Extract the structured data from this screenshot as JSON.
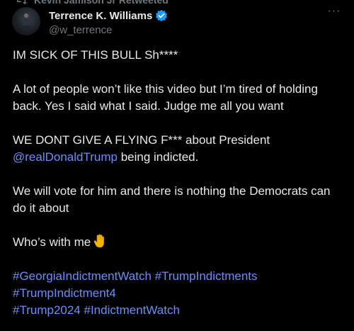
{
  "retweet": {
    "label": "Kevin Jamison Jr Retweeted",
    "icon": "retweet-icon"
  },
  "author": {
    "display_name": "Terrence K. Williams",
    "handle": "@w_terrence",
    "verified_icon": "verified-badge-icon",
    "avatar_icon": "avatar"
  },
  "menu": {
    "more_label": "···"
  },
  "tweet": {
    "line1": "IM SICK OF THIS BULL Sh****",
    "line2": "A lot of people won’t like this video  but I’m tired of holding back.  Yes I said what I said. Judge me all you want",
    "line3a": "WE DONT GIVE A FLYING F*** about President",
    "mention": "@realDonaldTrump",
    "line3b": " being indicted.",
    "line4": "We will vote for him and there is nothing the Democrats can do it about",
    "line5": "Who’s with me",
    "emoji": "raised-hand-emoji",
    "hashtags": [
      "#GeorgiaIndictmentWatch",
      "#TrumpIndictments",
      "#TrumpIndictment4",
      "#Trump2024",
      "#IndictmentWatch"
    ]
  },
  "colors": {
    "background": "#000000",
    "text": "#e7e9ea",
    "muted": "#71767b",
    "link": "#6e8ef7",
    "verified": "#1d9bf0"
  }
}
